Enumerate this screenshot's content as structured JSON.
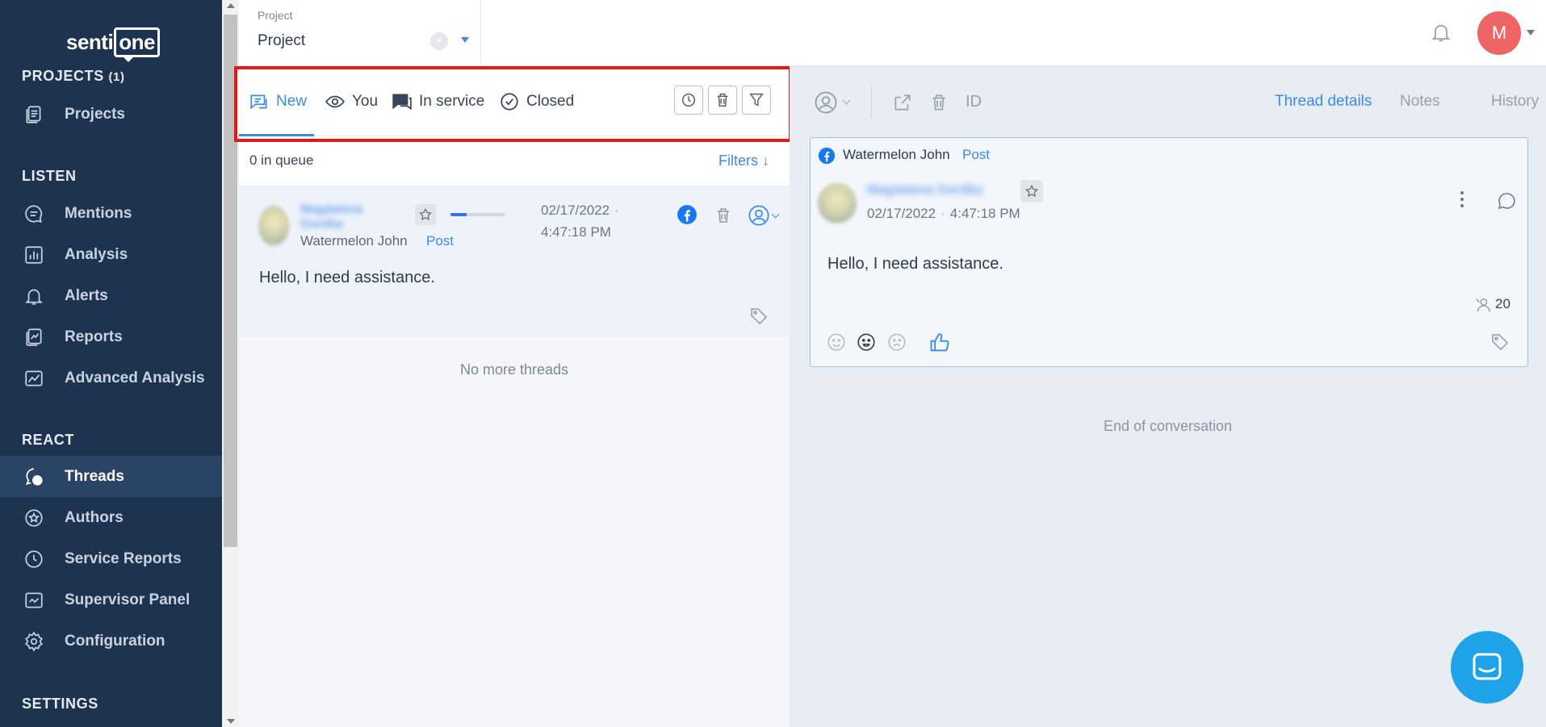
{
  "brand": {
    "logo_left": "senti",
    "logo_right": "one"
  },
  "sidebar": {
    "projects_title": "PROJECTS",
    "projects_count": "(1)",
    "listen_title": "LISTEN",
    "react_title": "REACT",
    "settings_title": "SETTINGS",
    "items": [
      {
        "label": "Projects",
        "icon": "projects-icon"
      },
      {
        "label": "Mentions",
        "icon": "mentions-icon"
      },
      {
        "label": "Analysis",
        "icon": "analysis-icon"
      },
      {
        "label": "Alerts",
        "icon": "bell-icon"
      },
      {
        "label": "Reports",
        "icon": "reports-icon"
      },
      {
        "label": "Advanced Analysis",
        "icon": "advanced-analysis-icon"
      },
      {
        "label": "Threads",
        "icon": "threads-icon",
        "active": true
      },
      {
        "label": "Authors",
        "icon": "authors-icon"
      },
      {
        "label": "Service Reports",
        "icon": "clock-icon"
      },
      {
        "label": "Supervisor Panel",
        "icon": "supervisor-icon"
      },
      {
        "label": "Configuration",
        "icon": "gear-icon"
      }
    ]
  },
  "topbar": {
    "project_caption": "Project",
    "project_value": "Project",
    "avatar_initial": "M"
  },
  "list": {
    "tabs": [
      {
        "label": "New",
        "icon": "inbox-icon",
        "active": true
      },
      {
        "label": "You",
        "icon": "eye-icon"
      },
      {
        "label": "In service",
        "icon": "chat-icon"
      },
      {
        "label": "Closed",
        "icon": "check-circle-icon"
      }
    ],
    "queue_text": "0 in queue",
    "filters_label": "Filters ↓",
    "no_more": "No more threads",
    "thread": {
      "blurred_name": "Magdalena Gordka",
      "author": "Watermelon John",
      "type": "Post",
      "date": "02/17/2022",
      "time": "4:47:18 PM",
      "message": "Hello, I need assistance.",
      "progress": 0.3
    }
  },
  "detail": {
    "id_label": "ID",
    "tabs": [
      {
        "label": "Thread details",
        "active": true
      },
      {
        "label": "Notes"
      },
      {
        "label": "History"
      }
    ],
    "post": {
      "author": "Watermelon John",
      "type": "Post",
      "blurred_name": "Magdalena Gordka",
      "date": "02/17/2022",
      "time": "4:47:18 PM",
      "message": "Hello, I need assistance.",
      "reach": "20"
    },
    "end_text": "End of conversation"
  },
  "colors": {
    "accent": "#3d8be8",
    "sidebar_bg": "#1e3350",
    "highlight": "#e01b1b",
    "avatar": "#ef6464"
  }
}
